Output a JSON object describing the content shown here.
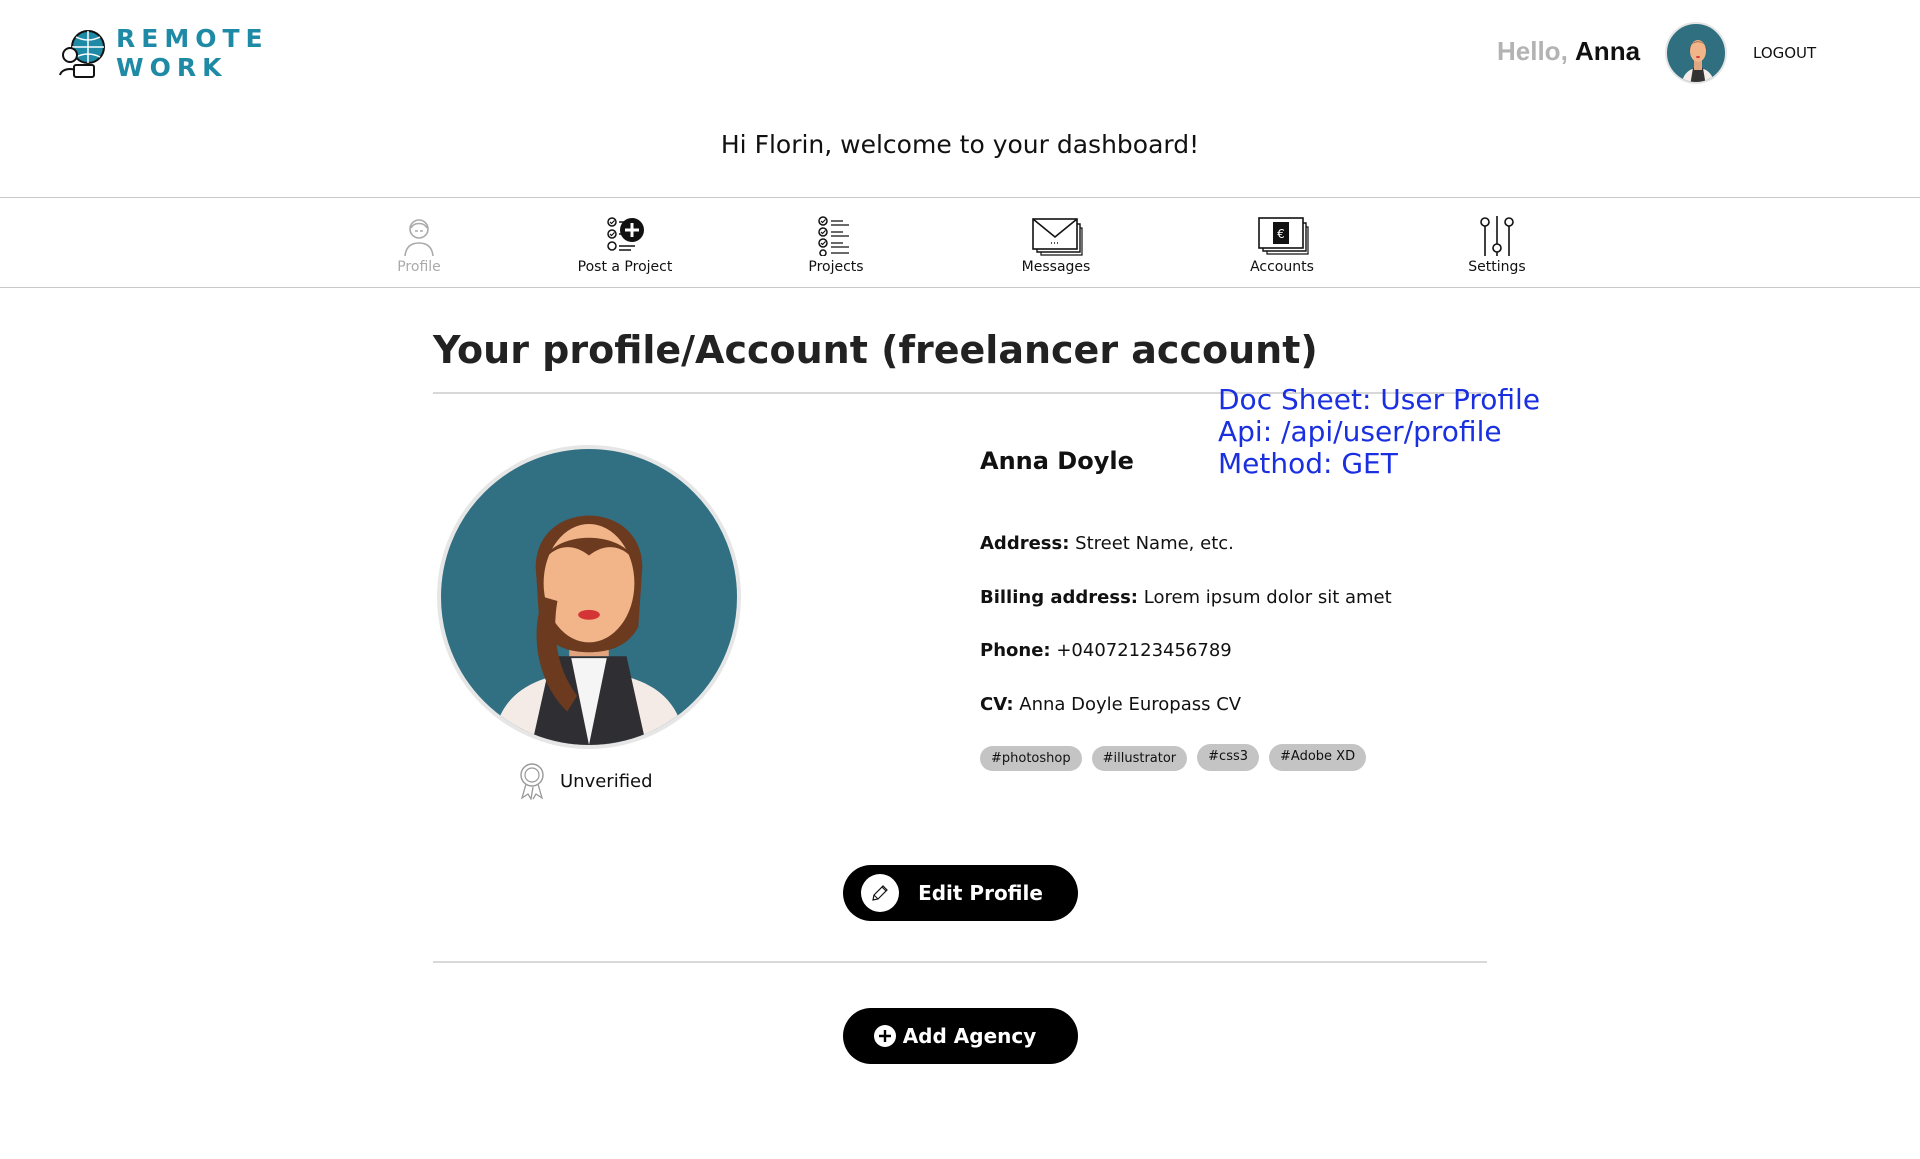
{
  "header": {
    "logo_line1": "REMOTE",
    "logo_line2": "WORK",
    "hello_prefix": "Hello,",
    "hello_name": "Anna",
    "logout_label": "LOGOUT",
    "welcome": "Hi Florin, welcome to your dashboard!"
  },
  "nav": {
    "items": [
      {
        "label": "Profile",
        "icon": "profile-icon",
        "active": true
      },
      {
        "label": "Post a Project",
        "icon": "post-project-icon"
      },
      {
        "label": "Projects",
        "icon": "projects-list-icon"
      },
      {
        "label": "Messages",
        "icon": "messages-icon"
      },
      {
        "label": "Accounts",
        "icon": "accounts-wallet-icon"
      },
      {
        "label": "Settings",
        "icon": "settings-sliders-icon"
      }
    ]
  },
  "main": {
    "title": "Your profile/Account (freelancer account)",
    "doc_note": {
      "line1": "Doc Sheet: User Profile",
      "line2": "Api: /api/user/profile",
      "line3": "Method: GET"
    },
    "verification_status": "Unverified",
    "profile": {
      "name": "Anna Doyle",
      "address_label": "Address:",
      "address_value": "Street Name, etc.",
      "billing_label": "Billing address:",
      "billing_value": "Lorem ipsum dolor sit amet",
      "phone_label": "Phone:",
      "phone_value": "+04072123456789",
      "cv_label": "CV:",
      "cv_value": "Anna Doyle Europass CV"
    },
    "tags": [
      "#photoshop",
      "#illustrator",
      "#css3",
      "#Adobe XD"
    ],
    "edit_button": "Edit Profile",
    "add_agency_button": "Add Agency"
  },
  "colors": {
    "brand": "#1f8aa6",
    "avatar_bg": "#316f82",
    "doc_note": "#1a2fe0",
    "tag_bg": "#c4c4c4",
    "button_bg": "#000000"
  }
}
